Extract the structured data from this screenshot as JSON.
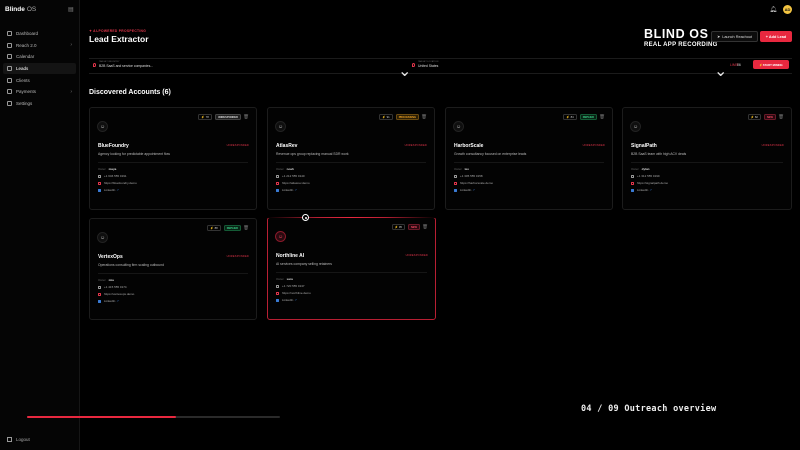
{
  "app": {
    "brand": "Blinde",
    "brand_suffix": "OS"
  },
  "sidebar": {
    "items": [
      {
        "label": "Dashboard",
        "icon": "dashboard-icon",
        "chevron": false,
        "active": false
      },
      {
        "label": "Reach 2.0",
        "icon": "reach-icon",
        "chevron": true,
        "active": false
      },
      {
        "label": "Calendar",
        "icon": "calendar-icon",
        "chevron": false,
        "active": false
      },
      {
        "label": "Leads",
        "icon": "leads-icon",
        "chevron": false,
        "active": true
      },
      {
        "label": "Clients",
        "icon": "clients-icon",
        "chevron": false,
        "active": false
      },
      {
        "label": "Payments",
        "icon": "payments-icon",
        "chevron": true,
        "active": false
      },
      {
        "label": "Settings",
        "icon": "settings-icon",
        "chevron": false,
        "active": false
      }
    ],
    "logout": "Logout"
  },
  "header": {
    "avatar_initials": "AD",
    "eyebrow": "AI-POWERED PROSPECTING",
    "title": "Lead Extractor",
    "hero_title": "BLIND OS",
    "hero_subtitle": "REAL APP RECORDING",
    "launch_label": "Launch Reachout",
    "add_label": "+ Add Lead"
  },
  "filters": {
    "industry_label": "TARGET INDUSTRY",
    "industry_value": "B2B SaaS and service companies...",
    "location_label": "TARGET LOCATION",
    "location_value": "United States",
    "limit_label": "LIMIT",
    "limit_value": "06",
    "start_label": "START MINING"
  },
  "section_title": "Discovered Accounts (6)",
  "cards": [
    {
      "name": "BlueFoundry",
      "score": "78",
      "status": "UNRESPONDED",
      "status_class": "st-unc",
      "unres": "UNRESPONDED",
      "desc": "Agency looking for predictable appointment flow",
      "owner_label": "Owner",
      "owner": "maya",
      "phone": "+1 646 555 0191",
      "site": "https://bluefoundry.demo",
      "linkedin": "LinkedIn"
    },
    {
      "name": "AtlasRev",
      "score": "91",
      "status": "PROCESSING",
      "status_class": "st-proc",
      "unres": "UNRESPONDED",
      "desc": "Revenue ops group replacing manual SDR work",
      "owner_label": "Owner",
      "owner": "noah",
      "phone": "+1 212 555 0140",
      "site": "https://atlasrev.demo",
      "linkedin": "LinkedIn"
    },
    {
      "name": "HarborScale",
      "score": "84",
      "status": "REPLIED",
      "status_class": "st-rep",
      "unres": "UNRESPONDED",
      "desc": "Growth consultancy focused on enterprise leads",
      "owner_label": "Owner",
      "owner": "leo",
      "phone": "+1 305 555 0158",
      "site": "https://harborscale.demo",
      "linkedin": "LinkedIn"
    },
    {
      "name": "SignalPath",
      "score": "82",
      "status": "NEW",
      "status_class": "st-new",
      "unres": "UNRESPONDED",
      "desc": "B2B SaaS team with high ACV deals",
      "owner_label": "Owner",
      "owner": "dylan",
      "phone": "+1 312 555 0199",
      "site": "https://signalpath.demo",
      "linkedin": "LinkedIn"
    },
    {
      "name": "VertexOps",
      "score": "88",
      "status": "REPLIED",
      "status_class": "st-rep",
      "unres": "UNRESPONDED",
      "desc": "Operations consulting firm scaling outbound",
      "owner_label": "Owner",
      "owner": "mia",
      "phone": "+1 415 555 0174",
      "site": "https://vertexops.demo",
      "linkedin": "LinkedIn"
    },
    {
      "name": "Northline AI",
      "score": "95",
      "status": "NEW",
      "status_class": "st-new",
      "unres": "UNRESPONDED",
      "desc": "AI services company selling retainers",
      "owner_label": "Owner",
      "owner": "sara",
      "phone": "+1 720 555 0137",
      "site": "https://northline.demo",
      "linkedin": "LinkedIn"
    }
  ],
  "footer": {
    "progress": 0.59,
    "step": "04 / 09  Outreach overview"
  }
}
